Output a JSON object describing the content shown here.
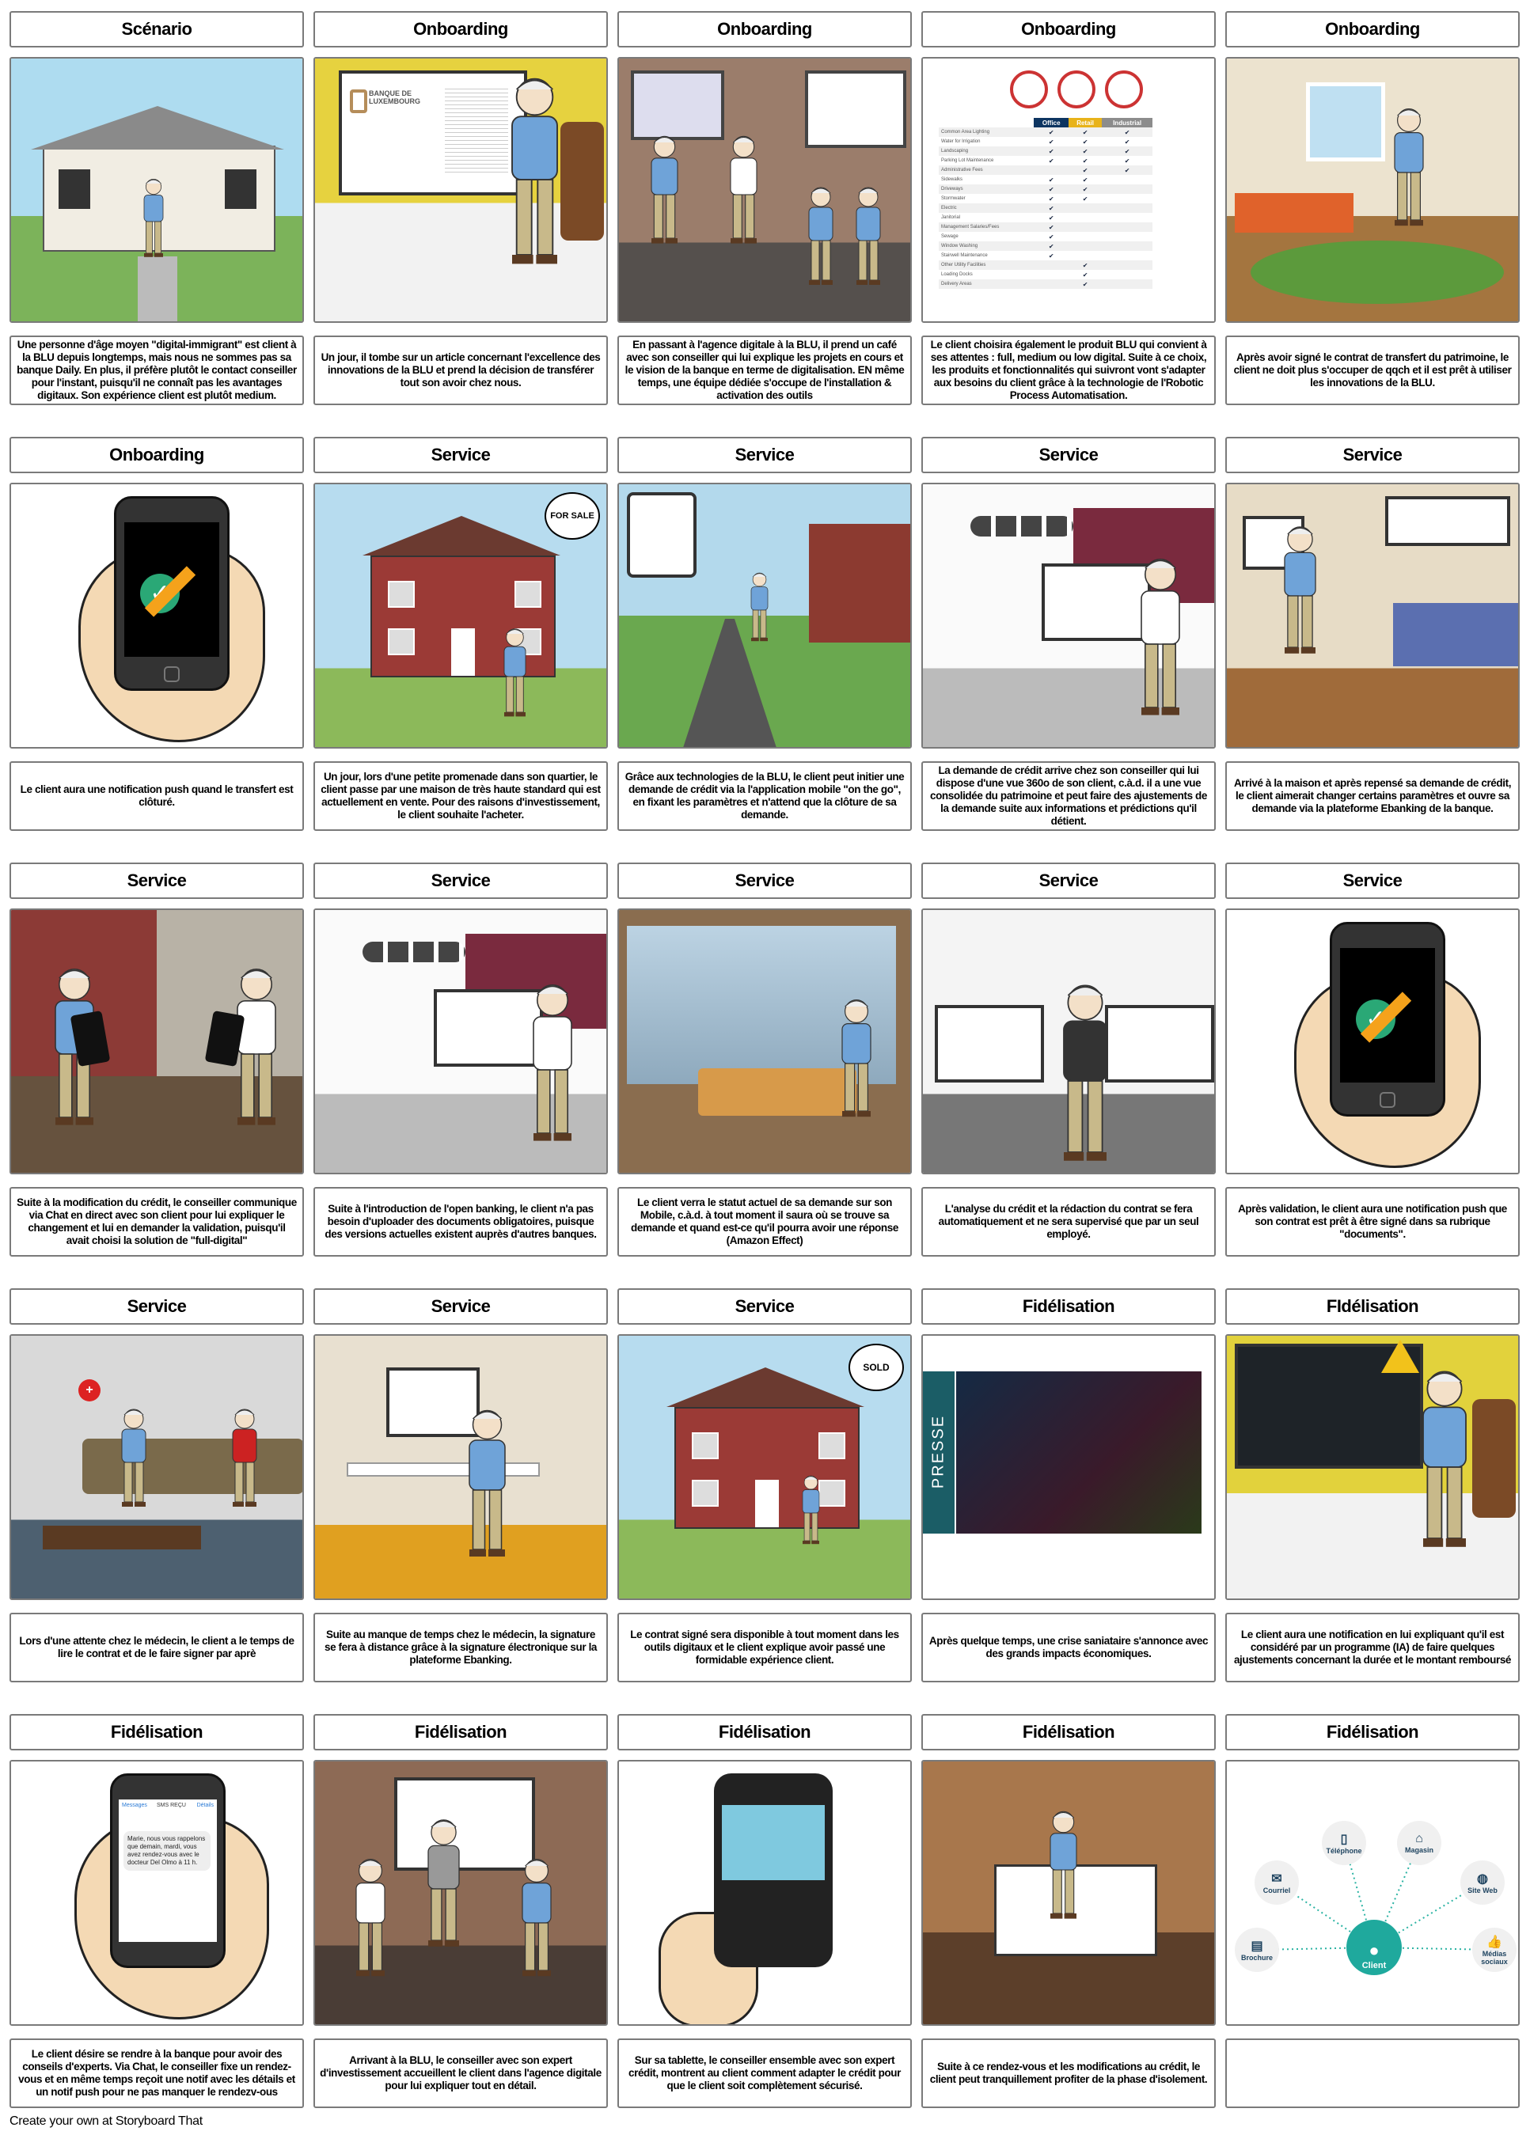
{
  "colors": {
    "office": "#0d3561",
    "retail": "#e8b31a",
    "industrial": "#8c8c8c",
    "client": "#1fa99d",
    "shirt": "#6fa3d8"
  },
  "panels": [
    {
      "title": "Scénario",
      "scene": "house",
      "caption": "Une personne d'âge moyen \"digital-immigrant\" est client à la BLU depuis longtemps, mais nous ne sommes pas sa banque Daily. En plus, il préfère plutôt le contact conseiller pour l'instant, puisqu'il ne connaît pas les avantages digitaux. Son expérience client est plutôt medium."
    },
    {
      "title": "Onboarding",
      "scene": "office-yellow",
      "caption": "Un jour, il tombe sur un article concernant l'excellence des innovations de la BLU et prend la décision de transférer tout son avoir chez nous.",
      "logo_text": "BANQUE DE LUXEMBOURG"
    },
    {
      "title": "Onboarding",
      "scene": "cafe",
      "caption": "En passant à l'agence digitale à la BLU, il prend un café avec son conseiller qui lui explique les projets en cours et le vision de la banque en terme de digitalisation. EN même temps, une équipe dédiée s'occupe de l'installation & activation des outils"
    },
    {
      "title": "Onboarding",
      "scene": "table",
      "caption": "Le client choisira également le produit BLU qui convient à ses attentes : full, medium ou low digital. Suite à ce choix, les produits et fonctionnalités qui suivront vont s'adapter aux besoins du client grâce à la technologie de l'Robotic Process Automatisation."
    },
    {
      "title": "Onboarding",
      "scene": "bedroom",
      "caption": "Après avoir signé le contrat de transfert du patrimoine, le client ne doit plus s'occuper de qqch et il est prêt à utiliser les innovations de la BLU."
    },
    {
      "title": "Onboarding",
      "scene": "phone",
      "caption": "Le client aura une notification push quand le transfert est clôturé."
    },
    {
      "title": "Service",
      "scene": "house-sale",
      "caption": "Un jour, lors d'une petite promenade dans son quartier, le client passe par une maison de très haute standard qui est actuellement en vente. Pour des raisons d'investissement, le client souhaite l'acheter.",
      "sign_text": "FOR SALE"
    },
    {
      "title": "Service",
      "scene": "street",
      "caption": "Grâce aux technologies de la BLU, le client peut initier une demande de crédit via la l'application mobile \"on the go\", en fixant les paramètres et n'attend que la clôture de sa demande."
    },
    {
      "title": "Service",
      "scene": "office-maroon",
      "caption": "La demande de crédit arrive chez son conseiller qui lui dispose d'une vue 360o de son client, c.à.d. il a une vue consolidée du patrimoine et peut faire des ajustements de la demande suite aux informations et prédictions qu'il détient."
    },
    {
      "title": "Service",
      "scene": "living",
      "caption": "Arrivé à la maison et après repensé sa demande de crédit, le client aimerait changer certains paramètres et ouvre sa demande via la plateforme Ebanking de la banque."
    },
    {
      "title": "Service",
      "scene": "chat",
      "caption": "Suite à la modification du crédit, le conseiller communique via Chat en direct avec son client pour lui expliquer le changement et lui en demander la validation, puisqu'il avait choisi la solution de \"full-digital\""
    },
    {
      "title": "Service",
      "scene": "office-maroon",
      "caption": "Suite à l'introduction de l'open banking, le client n'a pas besoin d'uploader des documents obligatoires, puisque des versions actuelles existent auprès d'autres banques."
    },
    {
      "title": "Service",
      "scene": "city",
      "caption": "Le client verra le statut actuel de sa demande sur son Mobile, c.à.d. à tout moment il saura où se trouve sa demande et quand est-ce qu'il pourra avoir une réponse (Amazon Effect)"
    },
    {
      "title": "Service",
      "scene": "monitors",
      "caption": "L'analyse du crédit et la rédaction du contrat se fera automatiquement et ne sera supervisé que par un seul employé."
    },
    {
      "title": "Service",
      "scene": "phone",
      "caption": "Après validation, le client aura une notification push que son contrat est prêt à être signé dans sa rubrique \"documents\"."
    },
    {
      "title": "Service",
      "scene": "waiting",
      "caption": "Lors d'une attente chez le médecin, le client a le temps de lire le contrat et de le faire signer par aprè"
    },
    {
      "title": "Service",
      "scene": "workspace",
      "caption": "Suite au manque de temps chez le médecin, la signature se fera à distance grâce à la signature électronique sur la plateforme Ebanking."
    },
    {
      "title": "Service",
      "scene": "house-sold",
      "caption": "Le contrat signé sera disponible à tout moment dans les outils digitaux et le client explique avoir passé une formidable expérience client.",
      "sign_text": "SOLD"
    },
    {
      "title": "Fidélisation",
      "scene": "presse",
      "caption": "Après quelque temps, une crise saniataire s'annonce avec des grands impacts économiques.",
      "press_text": "PRESSE"
    },
    {
      "title": "FIdélisation",
      "scene": "ai-office",
      "caption": "Le client aura une notification en lui expliquant qu'il est considéré par un programme (IA) de faire quelques ajustements concernant la durée et le montant remboursé"
    },
    {
      "title": "Fidélisation",
      "scene": "sms",
      "caption": "Le client désire se rendre à la banque pour avoir des conseils d'experts. Via Chat, le conseiller fixe un rendez-vous et en même temps reçoit une notif avec les détails et un notif push pour ne pas manquer le rendezv-ous"
    },
    {
      "title": "Fidélisation",
      "scene": "agency",
      "caption": "Arrivant à la BLU, le conseiller avec son expert d'investissement accueillent le client dans l'agence digitale pour lui expliquer tout en détail."
    },
    {
      "title": "Fidélisation",
      "scene": "phone-chart",
      "caption": "Sur sa tablette, le conseiller ensemble avec son expert crédit, montrent au client comment adapter le crédit pour que le client soit complètement sécurisé."
    },
    {
      "title": "Fidélisation",
      "scene": "bedroom2",
      "caption": "Suite à ce rendez-vous et les modifications au crédit, le client peut tranquillement profiter de la phase d'isolement."
    },
    {
      "title": "Fidélisation",
      "scene": "diagram",
      "caption": ""
    }
  ],
  "product_table": {
    "headers": [
      "Office",
      "Retail",
      "Industrial"
    ],
    "rows": [
      {
        "label": "Common Area Lighting",
        "checks": [
          true,
          true,
          true
        ]
      },
      {
        "label": "Water for Irrigation",
        "checks": [
          true,
          true,
          true
        ]
      },
      {
        "label": "Landscaping",
        "checks": [
          true,
          true,
          true
        ]
      },
      {
        "label": "Parking Lot Maintenance",
        "checks": [
          true,
          true,
          true
        ]
      },
      {
        "label": "Administrative Fees",
        "checks": [
          false,
          true,
          true
        ]
      },
      {
        "label": "Sidewalks",
        "checks": [
          true,
          true,
          false
        ]
      },
      {
        "label": "Driveways",
        "checks": [
          true,
          true,
          false
        ]
      },
      {
        "label": "Stormwater",
        "checks": [
          true,
          true,
          false
        ]
      },
      {
        "label": "Electric",
        "checks": [
          true,
          false,
          false
        ]
      },
      {
        "label": "Janitorial",
        "checks": [
          true,
          false,
          false
        ]
      },
      {
        "label": "Management Salaries/Fees",
        "checks": [
          true,
          false,
          false
        ]
      },
      {
        "label": "Sewage",
        "checks": [
          true,
          false,
          false
        ]
      },
      {
        "label": "Window Washing",
        "checks": [
          true,
          false,
          false
        ]
      },
      {
        "label": "Stairwell Maintenance",
        "checks": [
          true,
          false,
          false
        ]
      },
      {
        "label": "Other Utility Facilities",
        "checks": [
          false,
          true,
          false
        ]
      },
      {
        "label": "Loading Docks",
        "checks": [
          false,
          true,
          false
        ]
      },
      {
        "label": "Delivery Areas",
        "checks": [
          false,
          true,
          false
        ]
      }
    ]
  },
  "sms": {
    "back": "Messages",
    "title": "SMS REÇU",
    "details": "Détails",
    "body": "Marie, nous vous rappelons que demain, mardi, vous avez rendez-vous avec le docteur Del Olmo à 11 h."
  },
  "diagram": {
    "center": "Client",
    "nodes": [
      "Brochure",
      "Courriel",
      "Téléphone",
      "Magasin",
      "Site Web",
      "Médias sociaux"
    ]
  },
  "footer": "Create your own at Storyboard That"
}
